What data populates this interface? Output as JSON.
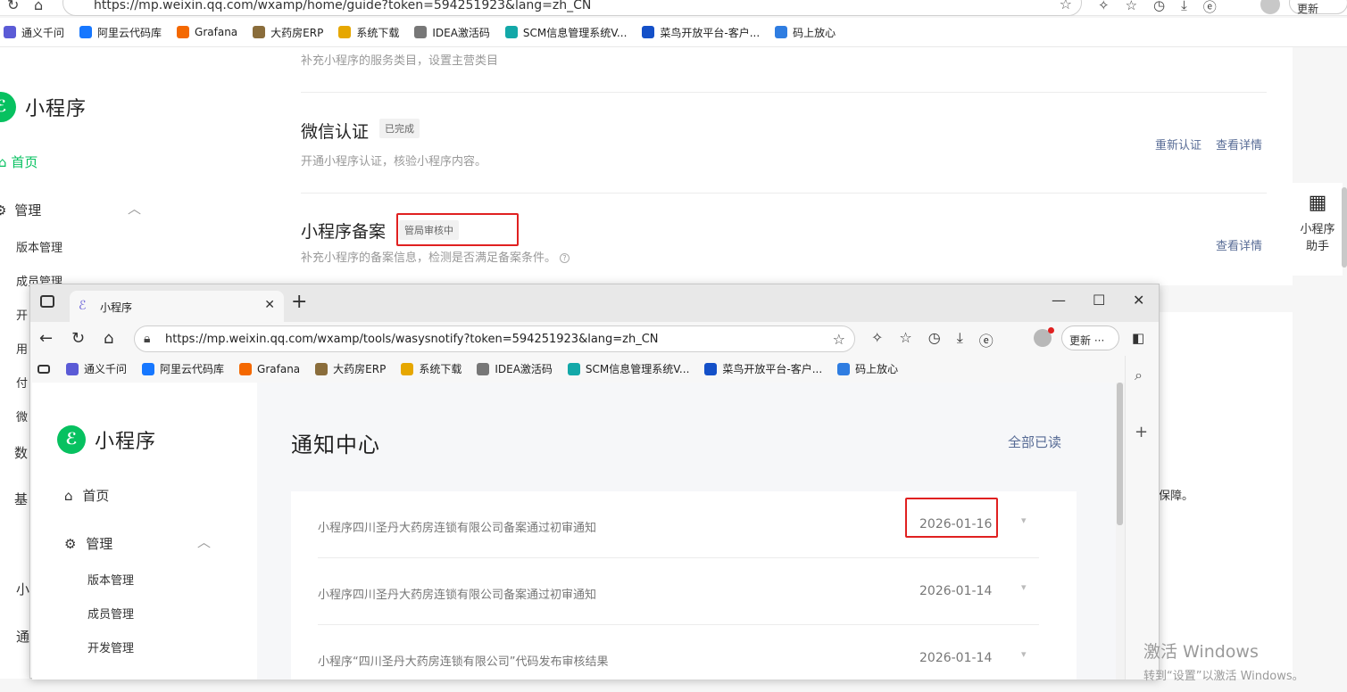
{
  "background_browser": {
    "url": "https://mp.weixin.qq.com/wxamp/home/guide?token=594251923&lang=zh_CN",
    "update_label": "更新",
    "bookmarks": [
      {
        "label": "通义千问",
        "color": "#5b5bd6"
      },
      {
        "label": "阿里云代码库",
        "color": "#1677ff"
      },
      {
        "label": "Grafana",
        "color": "#f46800"
      },
      {
        "label": "大药房ERP",
        "color": "#8a6d3b"
      },
      {
        "label": "系统下载",
        "color": "#e6a700"
      },
      {
        "label": "IDEA激活码",
        "color": "#777777"
      },
      {
        "label": "SCM信息管理系统V...",
        "color": "#13a8a8"
      },
      {
        "label": "菜鸟开放平台-客户...",
        "color": "#1450c8"
      },
      {
        "label": "码上放心",
        "color": "#2f7de1"
      }
    ]
  },
  "bg_sidebar": {
    "logo_text": "小程序",
    "home": "首页",
    "manage": "管理",
    "version_mgmt": "版本管理",
    "member_mgmt": "成员管理",
    "cut_items": [
      "开",
      "用",
      "付",
      "微",
      "数",
      "基",
      "小",
      "通"
    ]
  },
  "bg_main": {
    "row0_sub": "补充小程序的服务类目，设置主营类目",
    "row1": {
      "title": "微信认证",
      "badge": "已完成",
      "sub": "开通小程序认证，核验小程序内容。",
      "link1": "重新认证",
      "link2": "查看详情"
    },
    "row2": {
      "title": "小程序备案",
      "badge": "管局审核中",
      "sub": "补充小程序的备案信息，检测是否满足备案条件。",
      "link": "查看详情"
    },
    "cut_text": "保障。"
  },
  "assistant": {
    "label1": "小程序",
    "label2": "助手"
  },
  "watermark": {
    "line1": "激活 Windows",
    "line2": "转到“设置”以激活 Windows。"
  },
  "front_window": {
    "tab_title": "小程序",
    "url": "https://mp.weixin.qq.com/wxamp/tools/wasysnotify?token=594251923&lang=zh_CN",
    "update_label": "更新",
    "sidebar": {
      "logo_text": "小程序",
      "home": "首页",
      "manage": "管理",
      "version_mgmt": "版本管理",
      "member_mgmt": "成员管理",
      "dev_mgmt": "开发管理"
    },
    "page_title": "通知中心",
    "mark_all_read": "全部已读",
    "notifications": [
      {
        "title": "小程序四川圣丹大药房连锁有限公司备案通过初审通知",
        "date": "2026-01-16"
      },
      {
        "title": "小程序四川圣丹大药房连锁有限公司备案通过初审通知",
        "date": "2026-01-14"
      },
      {
        "title": "小程序“四川圣丹大药房连锁有限公司”代码发布审核结果",
        "date": "2026-01-14"
      }
    ]
  }
}
